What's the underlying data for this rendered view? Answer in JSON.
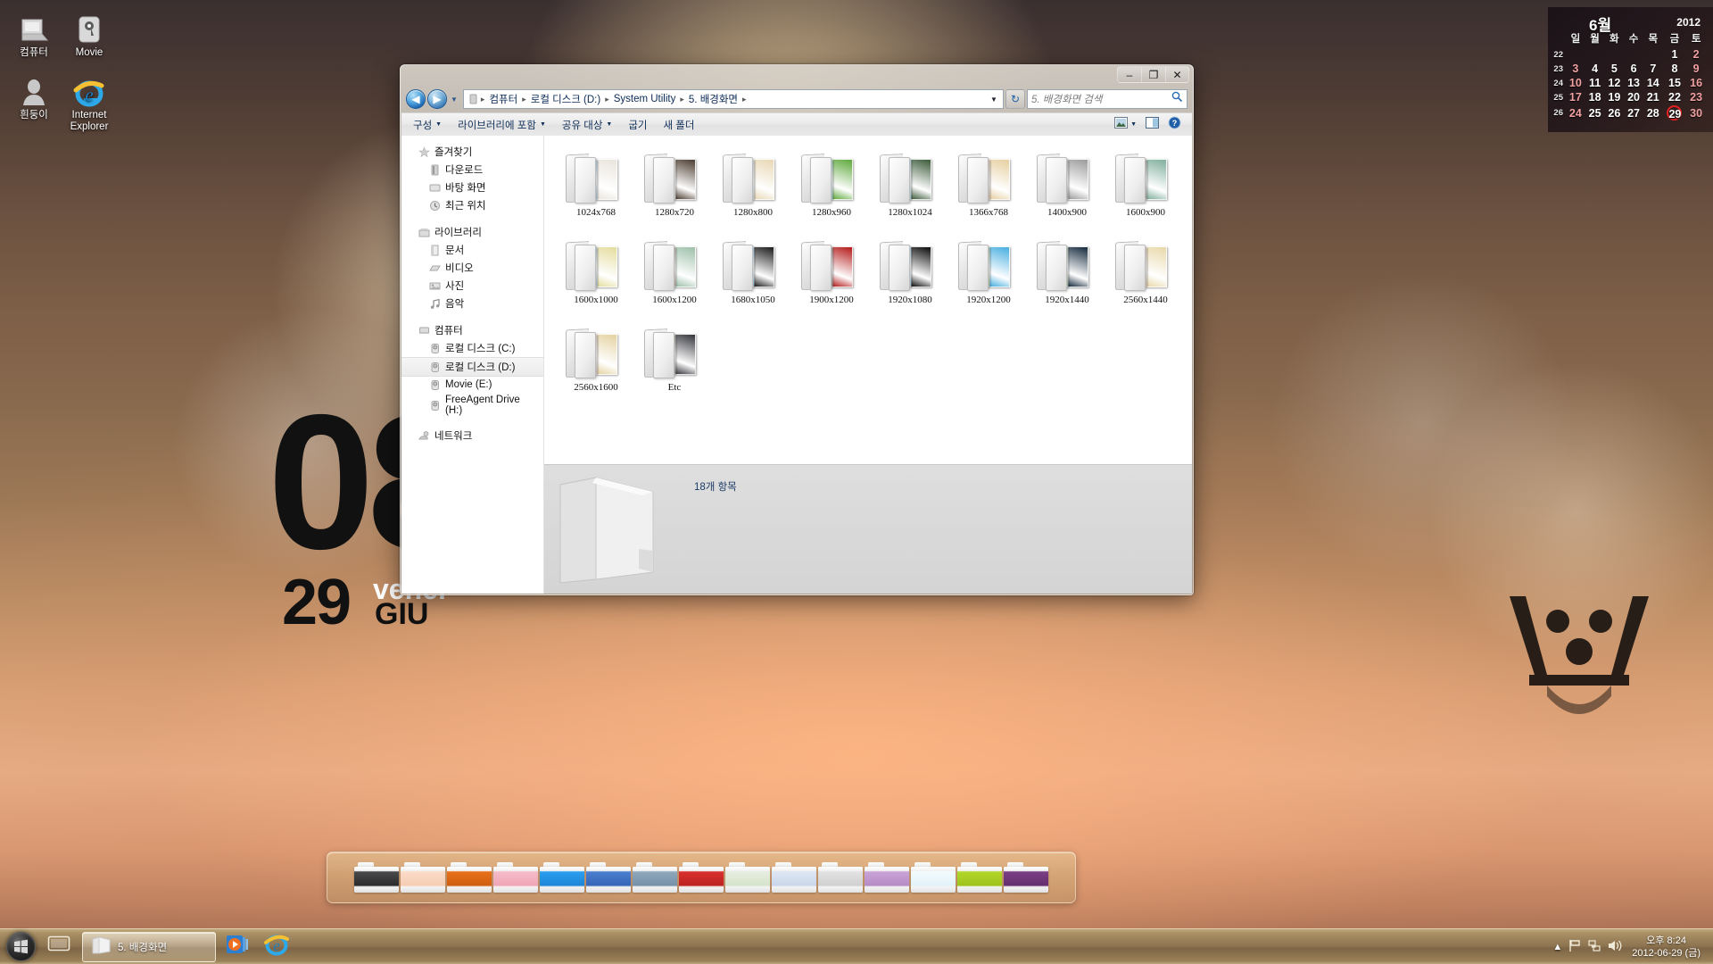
{
  "desktop": {
    "icons": [
      {
        "label": "컴퓨터",
        "icon": "computer-icon"
      },
      {
        "label": "Movie",
        "icon": "hard-drive-icon"
      },
      {
        "label": "흰둥이",
        "icon": "user-account-icon"
      },
      {
        "label": "Internet Explorer",
        "icon": "internet-explorer-icon"
      }
    ],
    "wallpaper_text": {
      "hour": "08",
      "day": "29",
      "weekday": "vener",
      "month": "GIU"
    }
  },
  "calendar": {
    "month": "6월",
    "year": "2012",
    "day_headers": [
      "일",
      "월",
      "화",
      "수",
      "목",
      "금",
      "토"
    ],
    "weeks": [
      {
        "wk": "22",
        "days": [
          "",
          "",
          "",
          "",
          "",
          "1",
          "2"
        ]
      },
      {
        "wk": "23",
        "days": [
          "3",
          "4",
          "5",
          "6",
          "7",
          "8",
          "9"
        ]
      },
      {
        "wk": "24",
        "days": [
          "10",
          "11",
          "12",
          "13",
          "14",
          "15",
          "16"
        ]
      },
      {
        "wk": "25",
        "days": [
          "17",
          "18",
          "19",
          "20",
          "21",
          "22",
          "23"
        ]
      },
      {
        "wk": "26",
        "days": [
          "24",
          "25",
          "26",
          "27",
          "28",
          "29",
          "30"
        ]
      }
    ],
    "today": "29",
    "today_color": "#e02020"
  },
  "explorer": {
    "window_buttons": {
      "minimize": "–",
      "maximize": "❐",
      "close": "✕"
    },
    "address": {
      "crumbs": [
        "컴퓨터",
        "로컬 디스크 (D:)",
        "System Utility",
        "5. 배경화면"
      ],
      "separator": "▸"
    },
    "search": {
      "placeholder": "5. 배경화면 검색",
      "icon": "search-icon"
    },
    "toolbar": {
      "items": [
        {
          "label": "구성",
          "has_caret": true
        },
        {
          "label": "라이브러리에 포함",
          "has_caret": true
        },
        {
          "label": "공유 대상",
          "has_caret": true
        },
        {
          "label": "굽기",
          "has_caret": false
        },
        {
          "label": "새 폴더",
          "has_caret": false
        }
      ],
      "right_icons": [
        "view-layout-icon",
        "chevron-down-icon",
        "preview-pane-icon",
        "help-icon"
      ]
    },
    "nav_pane": [
      {
        "head": {
          "label": "즐겨찾기",
          "icon": "favorites-star-icon"
        },
        "items": [
          {
            "label": "다운로드",
            "icon": "downloads-icon",
            "selected": false
          },
          {
            "label": "바탕 화면",
            "icon": "desktop-icon",
            "selected": false
          },
          {
            "label": "최근 위치",
            "icon": "recent-places-icon",
            "selected": false
          }
        ]
      },
      {
        "head": {
          "label": "라이브러리",
          "icon": "libraries-icon"
        },
        "items": [
          {
            "label": "문서",
            "icon": "documents-icon",
            "selected": false
          },
          {
            "label": "비디오",
            "icon": "videos-icon",
            "selected": false
          },
          {
            "label": "사진",
            "icon": "pictures-icon",
            "selected": false
          },
          {
            "label": "음악",
            "icon": "music-icon",
            "selected": false
          }
        ]
      },
      {
        "head": {
          "label": "컴퓨터",
          "icon": "computer-icon"
        },
        "items": [
          {
            "label": "로컬 디스크 (C:)",
            "icon": "hard-drive-icon",
            "selected": false
          },
          {
            "label": "로컬 디스크 (D:)",
            "icon": "hard-drive-icon",
            "selected": true
          },
          {
            "label": "Movie (E:)",
            "icon": "hard-drive-icon",
            "selected": false
          },
          {
            "label": "FreeAgent Drive (H:)",
            "icon": "hard-drive-icon",
            "selected": false
          }
        ]
      },
      {
        "head": {
          "label": "네트워크",
          "icon": "network-icon"
        },
        "items": []
      }
    ],
    "files": [
      {
        "name": "1024x768",
        "c1": "#2f7fbf",
        "c2": "#e9e4dc"
      },
      {
        "name": "1280x720",
        "c1": "#d8cfbe",
        "c2": "#4b3c30"
      },
      {
        "name": "1280x800",
        "c1": "#9bb7cf",
        "c2": "#e8d8b4"
      },
      {
        "name": "1280x960",
        "c1": "#2fa8c0",
        "c2": "#5ea83c"
      },
      {
        "name": "1280x1024",
        "c1": "#5ab4e0",
        "c2": "#3c5a3a"
      },
      {
        "name": "1366x768",
        "c1": "#c98a72",
        "c2": "#e7cfa0"
      },
      {
        "name": "1400x900",
        "c1": "#6b6b6b",
        "c2": "#9a9a9a"
      },
      {
        "name": "1600x900",
        "c1": "#4a3a2c",
        "c2": "#7fae9c"
      },
      {
        "name": "1600x1000",
        "c1": "#4a82c4",
        "c2": "#e4dc9c"
      },
      {
        "name": "1600x1200",
        "c1": "#8a4a2c",
        "c2": "#9cbfa8"
      },
      {
        "name": "1680x1050",
        "c1": "#2f9fd8",
        "c2": "#1a1a1a"
      },
      {
        "name": "1900x1200",
        "c1": "#2a2018",
        "c2": "#b41a1a"
      },
      {
        "name": "1920x1080",
        "c1": "#46aee0",
        "c2": "#0a0a0a"
      },
      {
        "name": "1920x1200",
        "c1": "#5aa038",
        "c2": "#46aee0"
      },
      {
        "name": "1920x1440",
        "c1": "#3c7a2c",
        "c2": "#14283c"
      },
      {
        "name": "2560x1440",
        "c1": "#c08a72",
        "c2": "#e8d8a8"
      },
      {
        "name": "2560x1600",
        "c1": "#c08a8a",
        "c2": "#e4d2a0"
      },
      {
        "name": "Etc",
        "c1": "#3a2a20",
        "c2": "#33343a"
      }
    ],
    "status": {
      "item_count": "18개 항목",
      "folder_icon": "large-folder-icon"
    }
  },
  "dock": {
    "folders": [
      {
        "c1": "#4a4a4c",
        "c2": "#2b2b2d"
      },
      {
        "c1": "#fbdbc8",
        "c2": "#f6cdb4"
      },
      {
        "c1": "#e8701a",
        "c2": "#cf5e10"
      },
      {
        "c1": "#f6bcc8",
        "c2": "#efa5b6"
      },
      {
        "c1": "#2a9eef",
        "c2": "#1f86d6"
      },
      {
        "c1": "#4b7fd0",
        "c2": "#3566b8"
      },
      {
        "c1": "#8fa8bb",
        "c2": "#7691a8"
      },
      {
        "c1": "#d8302e",
        "c2": "#bd2321"
      },
      {
        "c1": "#e6eedf",
        "c2": "#d6e3cc"
      },
      {
        "c1": "#dde6f3",
        "c2": "#cad6ea"
      },
      {
        "c1": "#e2e2e2",
        "c2": "#d0d0d0"
      },
      {
        "c1": "#c9a3d6",
        "c2": "#b68cc6"
      },
      {
        "c1": "#f2fbfd",
        "c2": "#e2f2f8"
      },
      {
        "c1": "#b2d62a",
        "c2": "#9ec41c"
      },
      {
        "c1": "#7b3f85",
        "c2": "#642f6d"
      }
    ]
  },
  "taskbar": {
    "start_icon": "windows-start-orb",
    "show_desktop_icon": "show-desktop-icon",
    "task": {
      "label": "5. 배경화면",
      "icon": "folder-icon"
    },
    "pinned": [
      {
        "icon": "media-player-icon"
      },
      {
        "icon": "internet-explorer-icon"
      }
    ],
    "tray": {
      "overflow_icon": "show-hidden-icons-chevron",
      "icons": [
        "action-center-flag-icon",
        "network-icon",
        "volume-icon"
      ],
      "time": "오후 8:24",
      "date": "2012-06-29 (금)"
    }
  }
}
